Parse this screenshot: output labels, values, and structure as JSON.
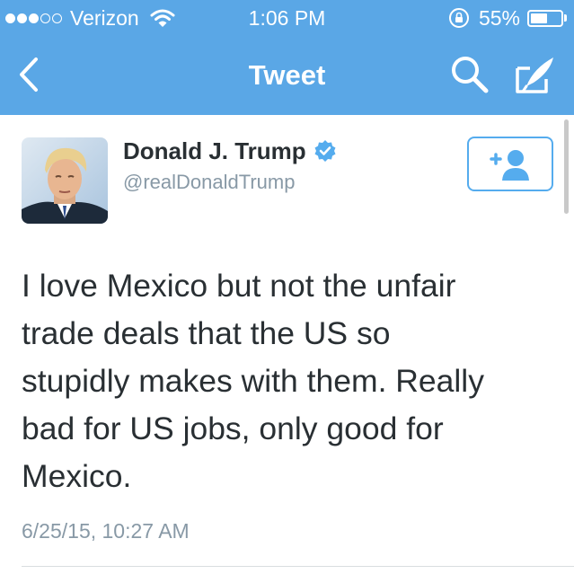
{
  "status_bar": {
    "carrier": "Verizon",
    "signal_dots_filled": 3,
    "signal_dots_total": 5,
    "time": "1:06 PM",
    "battery_percent": "55%",
    "battery_level": 0.55
  },
  "nav": {
    "title": "Tweet",
    "back_icon": "chevron-left-icon",
    "search_icon": "search-icon",
    "compose_icon": "compose-quill-icon"
  },
  "author": {
    "name": "Donald J. Trump",
    "handle": "@realDonaldTrump",
    "verified": true
  },
  "follow_button": {
    "icon": "add-user-icon"
  },
  "tweet": {
    "text": "I love Mexico but not the unfair trade deals that the US so stupidly makes with them. Really bad for US jobs, only good for Mexico.",
    "lines": [
      "I love Mexico but not the unfair",
      "trade deals that the US so",
      "stupidly makes with them. Really",
      "bad for US jobs, only good for",
      "Mexico."
    ],
    "timestamp": "6/25/15, 10:27 AM"
  },
  "colors": {
    "nav_background": "#5aa7e6",
    "accent": "#55acee",
    "text_primary": "#292f33",
    "text_secondary": "#8899a6"
  }
}
